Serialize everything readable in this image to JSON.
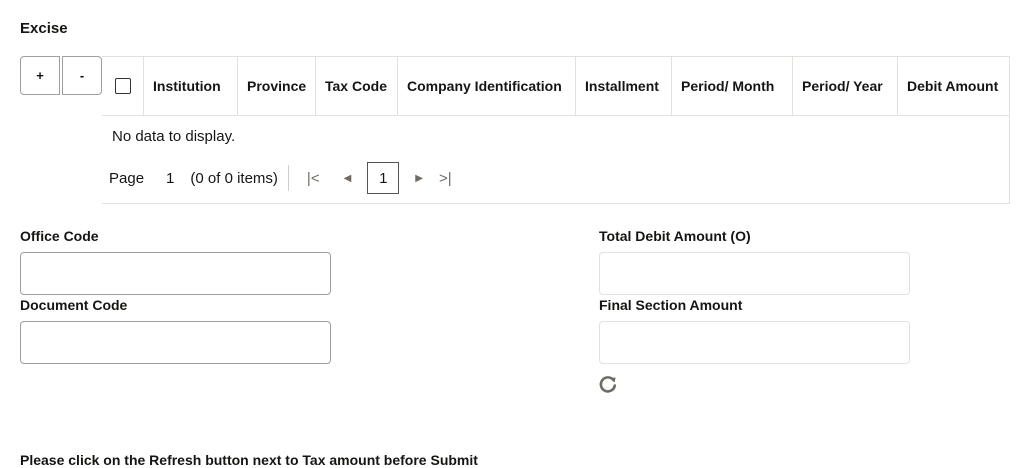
{
  "section": {
    "title": "Excise"
  },
  "buttons": {
    "add_label": "+",
    "remove_label": "-"
  },
  "table": {
    "columns": [
      "Institution",
      "Province",
      "Tax Code",
      "Company Identification",
      "Installment",
      "Period/ Month",
      "Period/ Year",
      "Debit Amount"
    ],
    "empty_message": "No data to display.",
    "pager": {
      "page_label": "Page",
      "page_number": "1",
      "items_info": "(0 of 0 items)",
      "current_page": "1",
      "first_icon": "|<",
      "prev_icon": "◀",
      "next_icon": "▶",
      "last_icon": ">|"
    }
  },
  "form": {
    "office_code": {
      "label": "Office Code",
      "value": ""
    },
    "document_code": {
      "label": "Document Code",
      "value": ""
    },
    "total_debit_amount": {
      "label": "Total Debit Amount (O)",
      "value": ""
    },
    "final_section_amount": {
      "label": "Final Section Amount",
      "value": ""
    }
  },
  "icons": {
    "refresh": "refresh-icon"
  },
  "note": "Please click on the Refresh button next to Tax amount before Submit"
}
